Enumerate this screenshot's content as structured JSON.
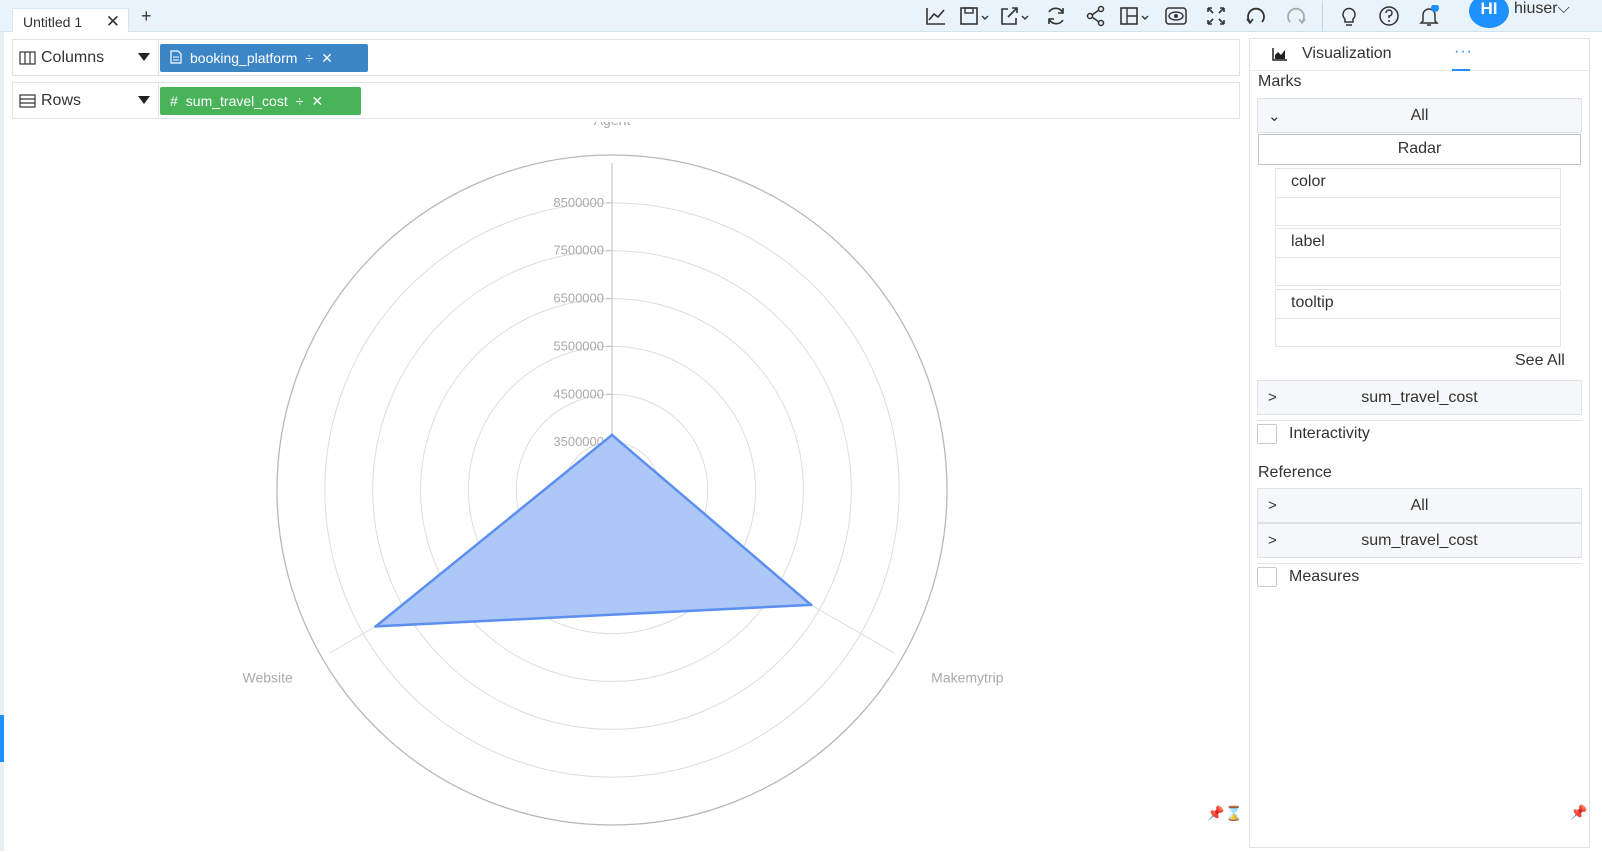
{
  "tabs": [
    {
      "label": "Untitled 1"
    }
  ],
  "user": {
    "initials": "HI",
    "name": "hiuser"
  },
  "shelves": {
    "columns": {
      "label": "Columns",
      "pill": "booking_platform"
    },
    "rows": {
      "label": "Rows",
      "pill": "sum_travel_cost"
    }
  },
  "panel": {
    "tab_label": "Visualization",
    "more": "···",
    "marks_label": "Marks",
    "marks_all": "All",
    "chart_type": "Radar",
    "slots": [
      "color",
      "label",
      "tooltip"
    ],
    "see_all": "See All",
    "marks_measure": "sum_travel_cost",
    "interactivity": "Interactivity",
    "reference_label": "Reference",
    "reference_all": "All",
    "reference_measure": "sum_travel_cost",
    "measures": "Measures"
  },
  "colors": {
    "accent": "#1e90ff",
    "pill_blue": "#3d86c6",
    "pill_green": "#49b35a",
    "series_fill": "#a9c4f7",
    "series_line": "#5b8ff0"
  },
  "chart_data": {
    "type": "radar",
    "categories": [
      "Agent",
      "Makemytrip",
      "Website"
    ],
    "series": [
      {
        "values": [
          3650000,
          7300000,
          8200000
        ]
      }
    ],
    "radial_ticks": [
      3500000,
      4500000,
      5500000,
      6500000,
      7500000,
      8500000
    ],
    "rlim": [
      2500000,
      9500000
    ],
    "grid": true
  }
}
